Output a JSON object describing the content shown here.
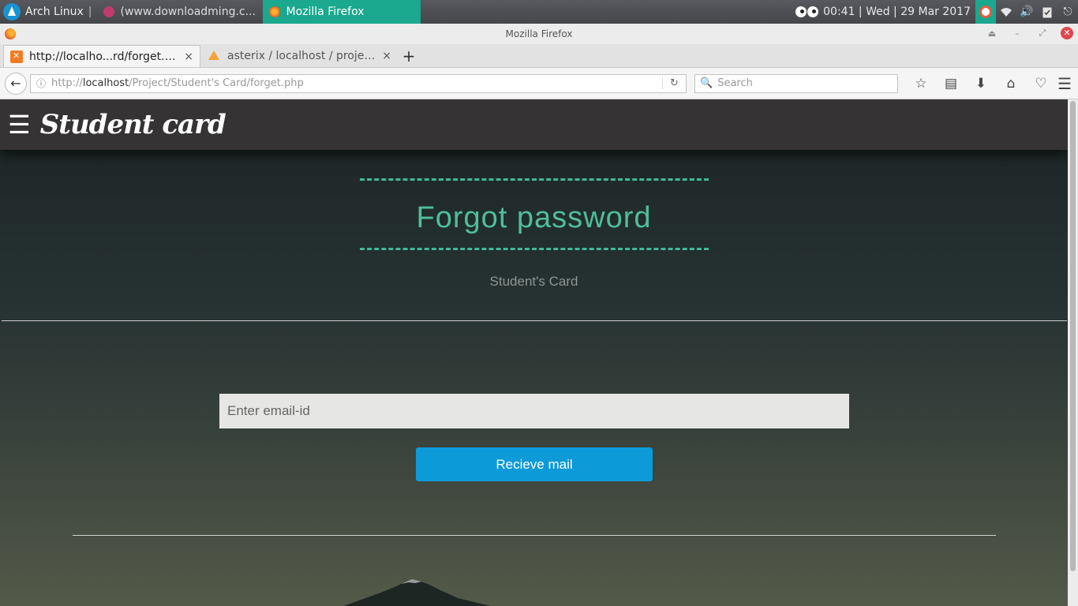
{
  "taskbar": {
    "os_label": "Arch Linux",
    "separator": "|",
    "tasks": [
      {
        "label": "(www.downloadming.c...",
        "active": false
      },
      {
        "label": "Mozilla Firefox",
        "active": true
      }
    ],
    "clock": "00:41  |  Wed  |  29 Mar 2017"
  },
  "window": {
    "title": "Mozilla Firefox"
  },
  "tabs": [
    {
      "title": "http://localho...rd/forget.php",
      "close": "×"
    },
    {
      "title": "asterix / localhost / project ...",
      "close": "×"
    }
  ],
  "toolbar": {
    "url_scheme": "http://",
    "url_host": "localhost",
    "url_path": "/Project/Student's Card/forget.php",
    "search_placeholder": "Search"
  },
  "page": {
    "brand": "Student card",
    "heading": "Forgot password",
    "subtitle": "Student's Card",
    "email_placeholder": "Enter email-id",
    "email_value": "",
    "submit_label": "Recieve mail"
  },
  "colors": {
    "accent_green": "#4fbe99",
    "button_blue": "#0d9ad8",
    "taskbar_active": "#1aa88e"
  }
}
